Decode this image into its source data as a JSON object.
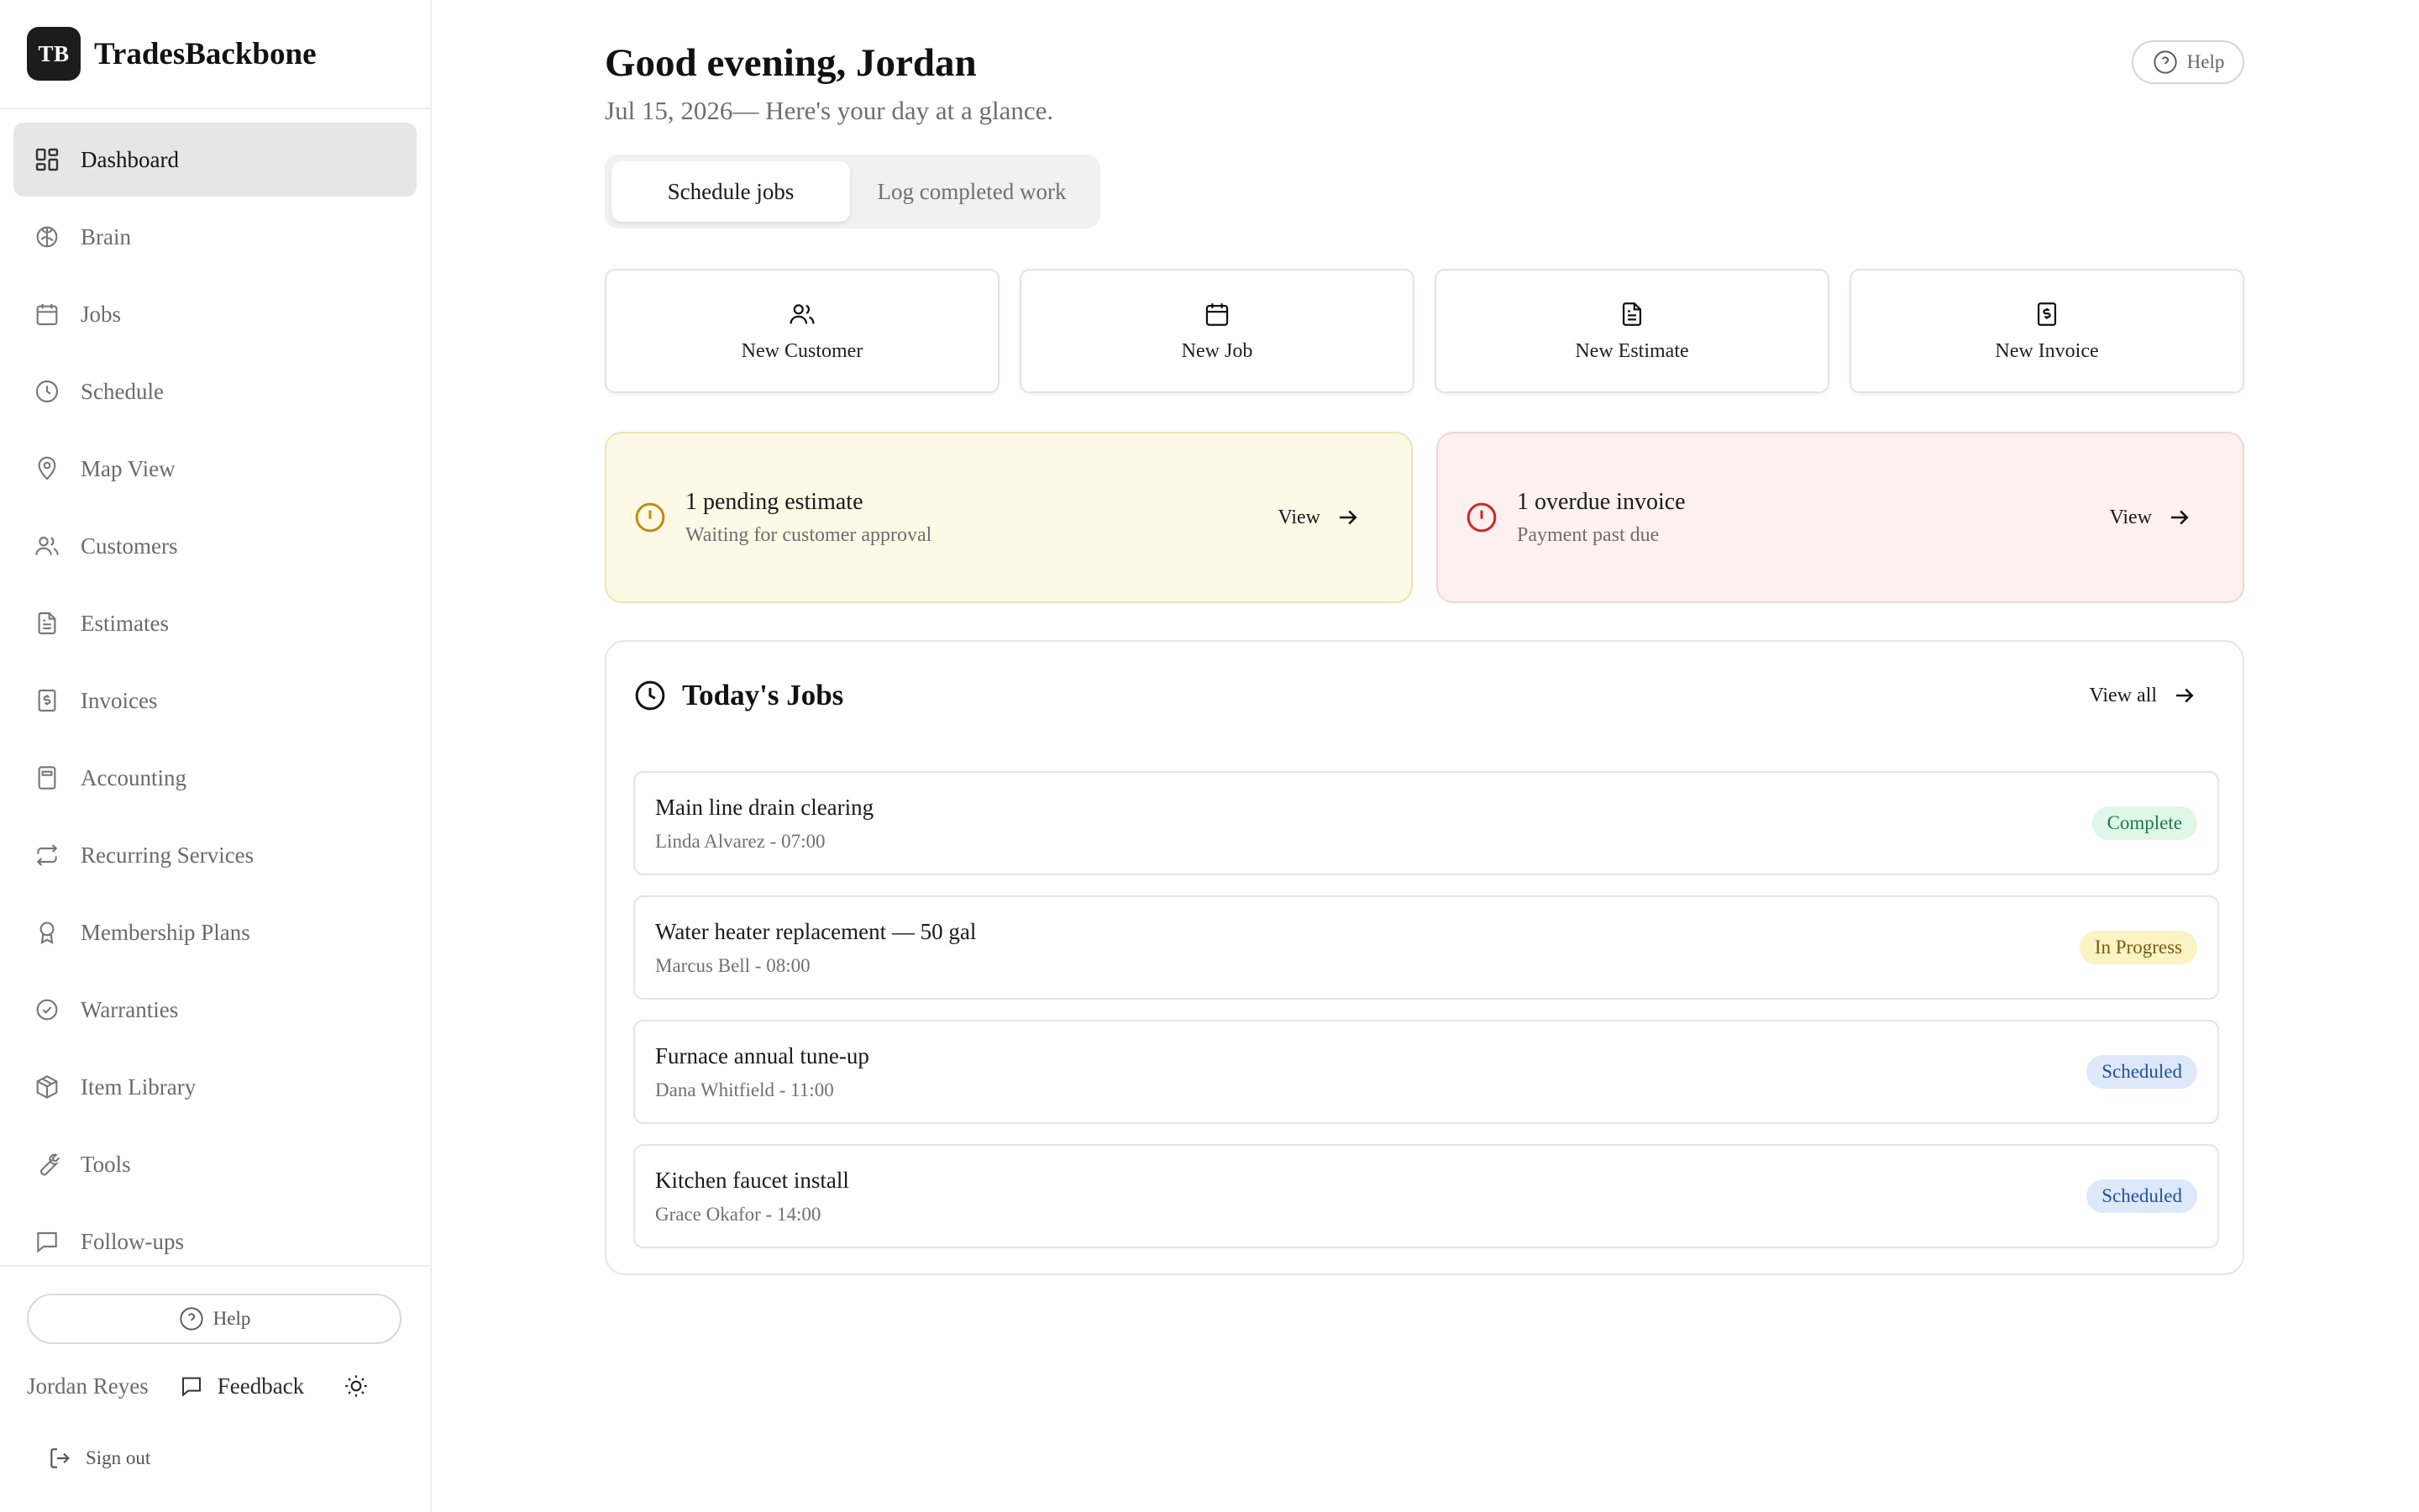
{
  "brand": {
    "logo_text": "TB",
    "name": "TradesBackbone"
  },
  "sidebar": {
    "items": [
      {
        "label": "Dashboard",
        "icon": "dashboard-icon",
        "active": true
      },
      {
        "label": "Brain",
        "icon": "brain-icon"
      },
      {
        "label": "Jobs",
        "icon": "calendar-icon"
      },
      {
        "label": "Schedule",
        "icon": "clock-icon"
      },
      {
        "label": "Map View",
        "icon": "map-pin-icon"
      },
      {
        "label": "Customers",
        "icon": "users-icon"
      },
      {
        "label": "Estimates",
        "icon": "document-icon"
      },
      {
        "label": "Invoices",
        "icon": "receipt-icon"
      },
      {
        "label": "Accounting",
        "icon": "calculator-icon"
      },
      {
        "label": "Recurring Services",
        "icon": "repeat-icon"
      },
      {
        "label": "Membership Plans",
        "icon": "award-icon"
      },
      {
        "label": "Warranties",
        "icon": "check-badge-icon"
      },
      {
        "label": "Item Library",
        "icon": "package-icon"
      },
      {
        "label": "Tools",
        "icon": "wrench-icon"
      },
      {
        "label": "Follow-ups",
        "icon": "message-icon"
      }
    ],
    "help_label": "Help",
    "user_name": "Jordan Reyes",
    "feedback_label": "Feedback",
    "signout_label": "Sign out"
  },
  "header": {
    "greeting": "Good evening, Jordan",
    "subline": "Jul 15, 2026— Here's your day at a glance.",
    "help_label": "Help"
  },
  "tabs": {
    "active": "Schedule jobs",
    "inactive": "Log completed work"
  },
  "quick_actions": [
    {
      "label": "New Customer",
      "icon": "users-icon"
    },
    {
      "label": "New Job",
      "icon": "calendar-icon"
    },
    {
      "label": "New Estimate",
      "icon": "document-icon"
    },
    {
      "label": "New Invoice",
      "icon": "receipt-icon"
    }
  ],
  "alerts": {
    "pending": {
      "title": "1 pending estimate",
      "subtitle": "Waiting for customer approval",
      "link": "View",
      "color": "#c58a12"
    },
    "overdue": {
      "title": "1 overdue invoice",
      "subtitle": "Payment past due",
      "link": "View",
      "color": "#d42424"
    }
  },
  "todays_jobs": {
    "title": "Today's Jobs",
    "view_all": "View all",
    "jobs": [
      {
        "title": "Main line drain clearing",
        "meta": "Linda Alvarez - 07:00",
        "status": "Complete"
      },
      {
        "title": "Water heater replacement — 50 gal",
        "meta": "Marcus Bell - 08:00",
        "status": "In Progress"
      },
      {
        "title": "Furnace annual tune-up",
        "meta": "Dana Whitfield - 11:00",
        "status": "Scheduled"
      },
      {
        "title": "Kitchen faucet install",
        "meta": "Grace Okafor - 14:00",
        "status": "Scheduled"
      }
    ]
  }
}
